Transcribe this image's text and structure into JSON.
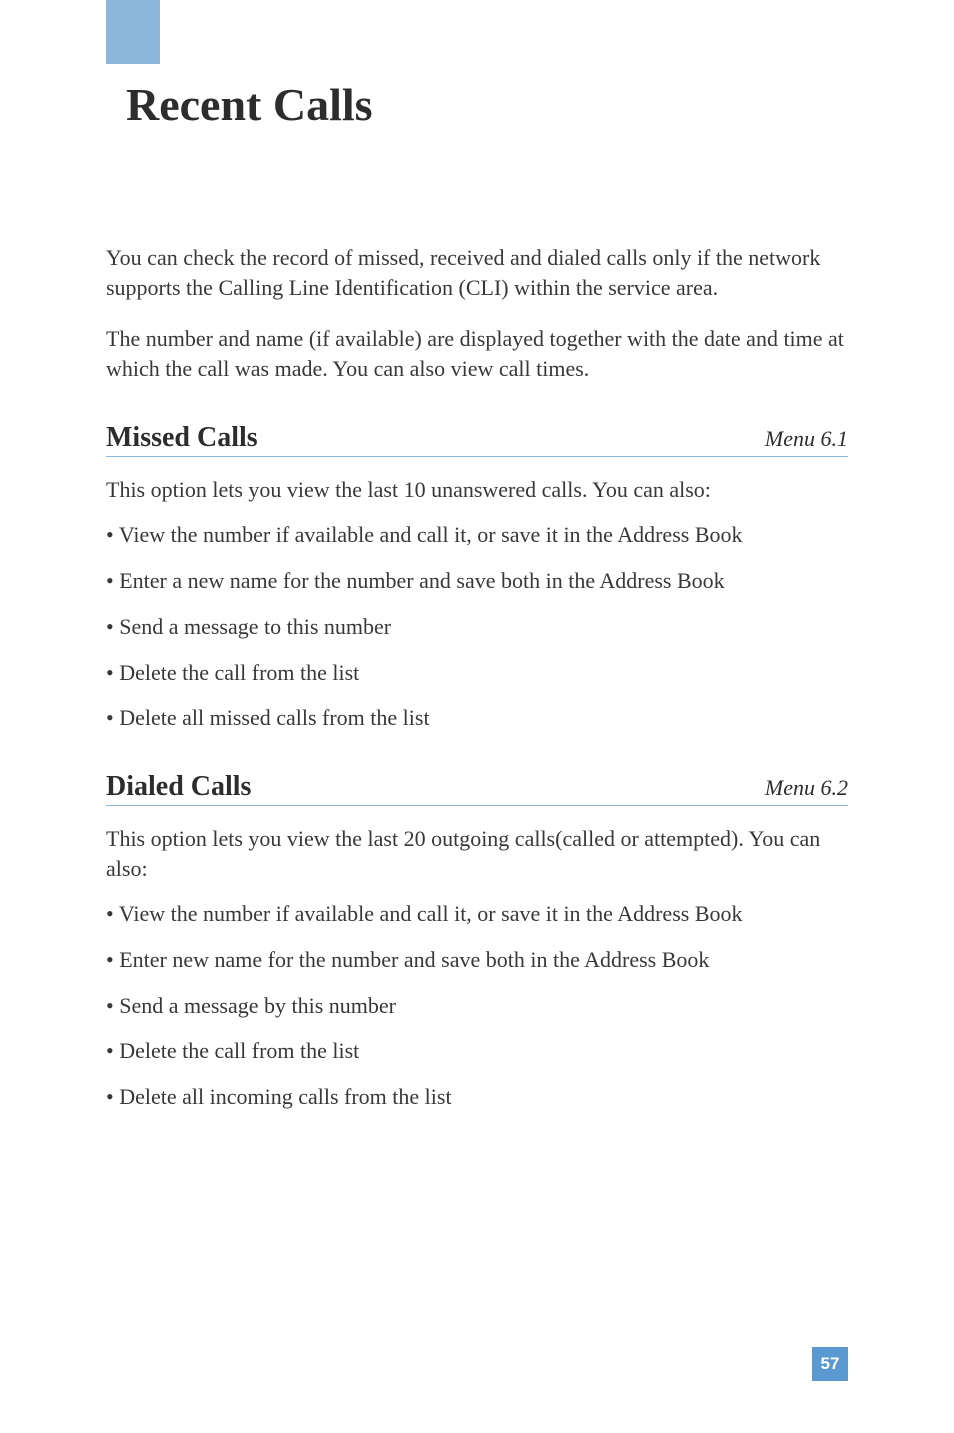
{
  "page_title": "Recent Calls",
  "intro_paragraphs": [
    "You can check the record of missed, received and dialed calls only if the network supports the Calling Line Identification (CLI) within the service area.",
    "The number and name (if available) are displayed together with the date and time at which the call was made. You can also view call times."
  ],
  "sections": [
    {
      "title": "Missed Calls",
      "menu_ref": "Menu 6.1",
      "intro": "This option lets you view the last 10 unanswered calls. You can also:",
      "bullets": [
        "View the number if available and call it, or save it in the Address Book",
        "Enter a new name for the number and save both in the Address Book",
        "Send a message to this number",
        "Delete the call from the list",
        "Delete all missed calls from the list"
      ]
    },
    {
      "title": "Dialed Calls",
      "menu_ref": "Menu 6.2",
      "intro": "This option lets you view the last 20 outgoing calls(called or attempted). You can also:",
      "bullets": [
        "View the number if available and call it, or save it in the Address Book",
        "Enter new name for the number and save both in the Address Book",
        "Send a message by this number",
        "Delete the call from the list",
        "Delete all incoming calls from the list"
      ]
    }
  ],
  "page_number": "57"
}
